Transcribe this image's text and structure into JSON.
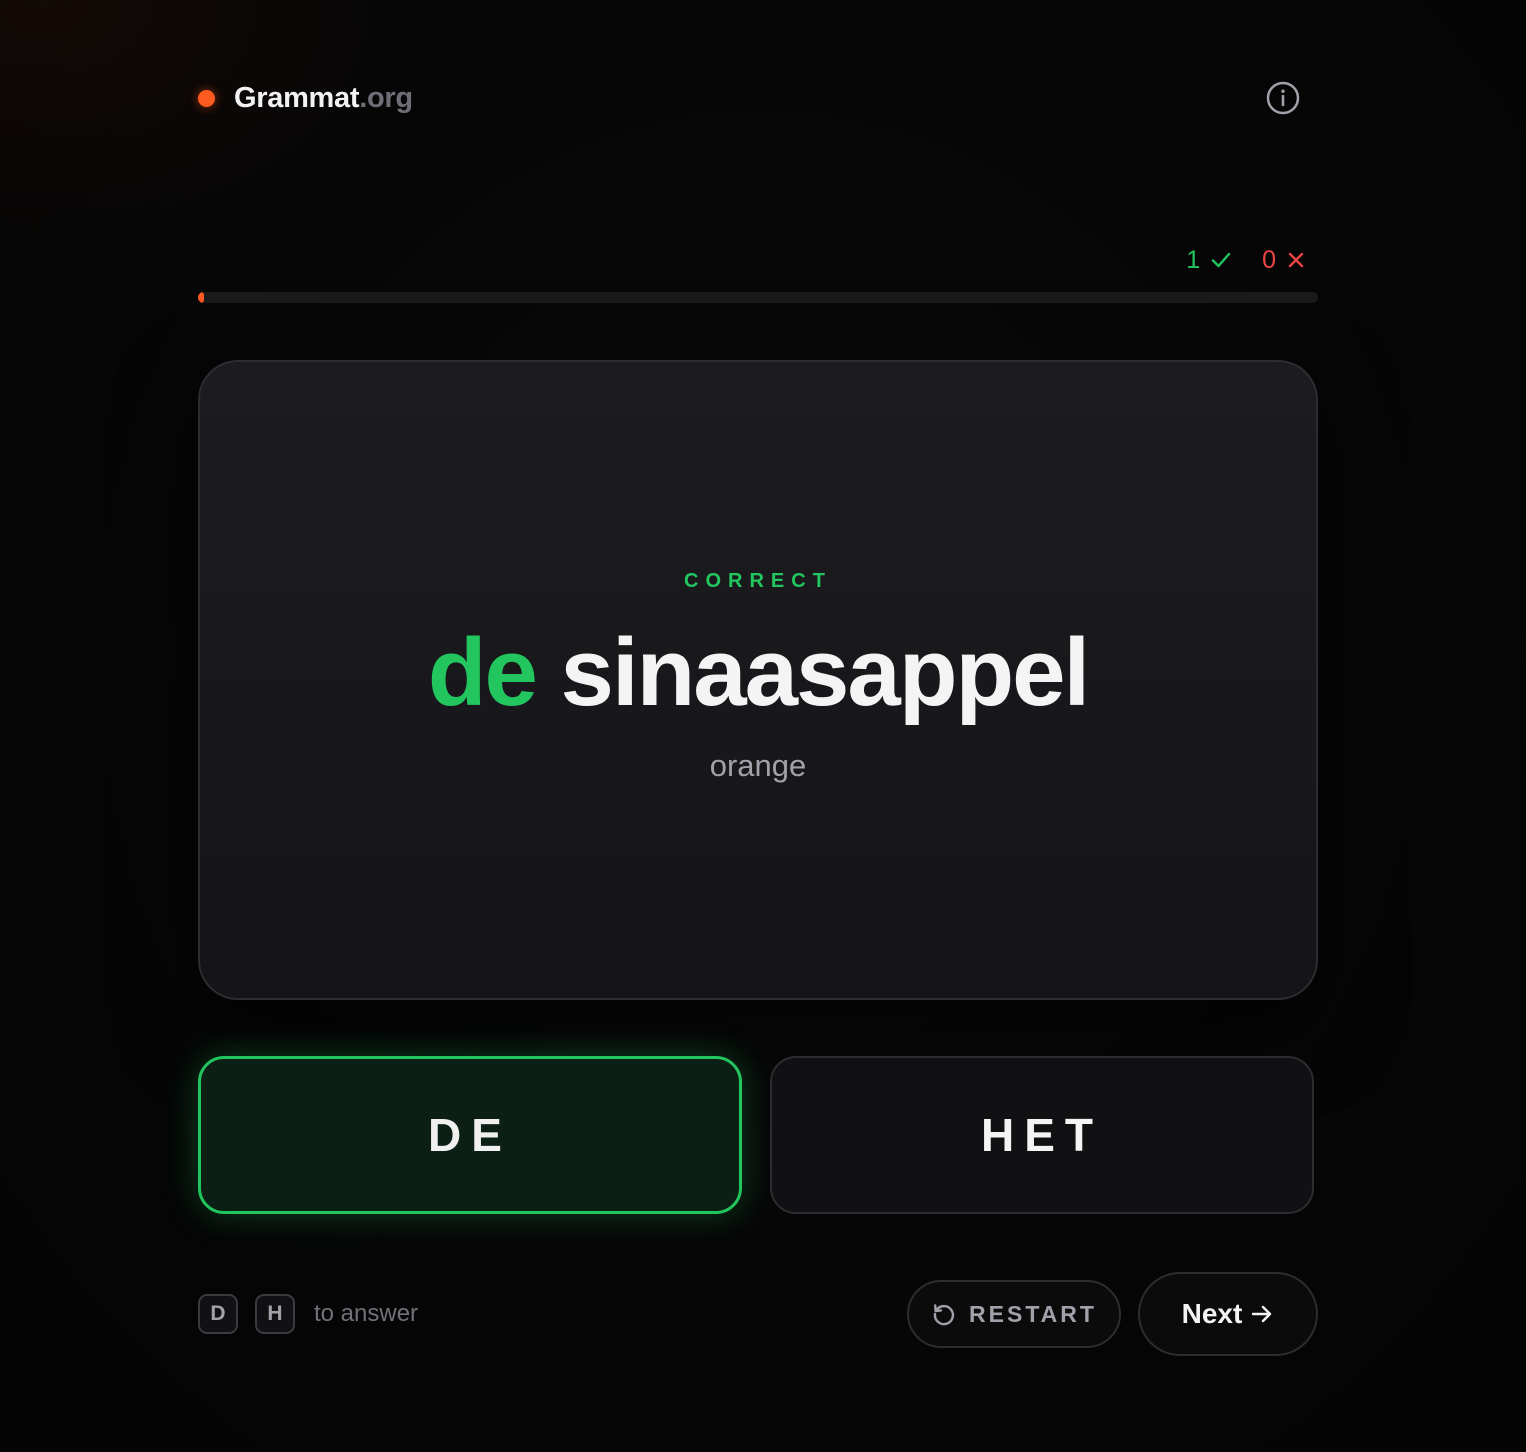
{
  "header": {
    "brand_name": "Grammat",
    "brand_tld": ".org",
    "info_icon": "info-icon"
  },
  "score": {
    "correct": "1",
    "wrong": "0",
    "correct_icon": "check-icon",
    "wrong_icon": "cross-icon"
  },
  "progress": {
    "fraction": 0.005
  },
  "card": {
    "status": "CORRECT",
    "article": "de",
    "noun": "sinaasappel",
    "translation": "orange"
  },
  "answers": {
    "de_label": "DE",
    "het_label": "HET"
  },
  "footer": {
    "key_de": "D",
    "key_het": "H",
    "hint": "to answer",
    "restart_label": "RESTART",
    "restart_icon": "restart-icon",
    "next_label": "Next",
    "next_icon": "arrow-right-icon"
  },
  "colors": {
    "accent": "#ff5a1f",
    "correct": "#22c55e",
    "wrong": "#ef4444",
    "background": "#050505",
    "card": "#18181b"
  }
}
